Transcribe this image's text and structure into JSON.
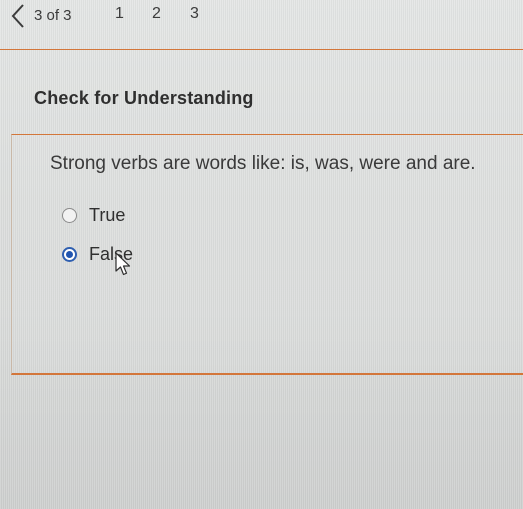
{
  "navigation": {
    "back_icon": "chevron-left-icon",
    "page_indicator": "3 of 3",
    "pages": [
      "1",
      "2",
      "3"
    ]
  },
  "section": {
    "heading": "Check for Understanding"
  },
  "question": {
    "prompt": "Strong verbs are words like: is, was, were and are.",
    "options": [
      {
        "label": "True",
        "selected": false
      },
      {
        "label": "False",
        "selected": true
      }
    ]
  },
  "pointer": {
    "icon": "mouse-pointer-icon"
  },
  "colors": {
    "accent_orange": "#d3763a",
    "radio_selected_blue": "#2155b0",
    "background": "#dcdedd"
  }
}
